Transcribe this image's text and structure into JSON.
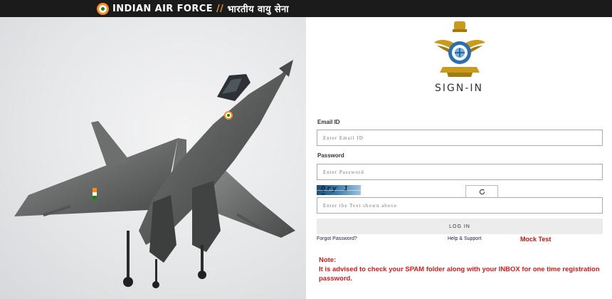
{
  "header": {
    "title_en": "INDIAN AIR FORCE",
    "separator": "//",
    "title_hi": "भारतीय वायु सेना"
  },
  "hero": {
    "image_alt": "Fighter jet in flight"
  },
  "form": {
    "heading": "SIGN-IN",
    "email_label": "Email ID",
    "email_placeholder": "Enter Email ID",
    "password_label": "Password",
    "password_placeholder": "Enter Password",
    "captcha_text": "Qry 1 5",
    "captcha_placeholder": "Enter the Text shown above",
    "login_button": "LOG IN",
    "forgot_password": "Forgot Password?",
    "help_support": "Help & Support",
    "mock_test": "Mock Test"
  },
  "note": {
    "heading": "Note:",
    "text": "It is advised to check your SPAM folder along with your INBOX for one time registration password."
  },
  "colors": {
    "topbar": "#1b1b1b",
    "note_red": "#e01818",
    "mock_red": "#cc1111",
    "roundel_saffron": "#ff8c1a",
    "roundel_green": "#138808"
  }
}
